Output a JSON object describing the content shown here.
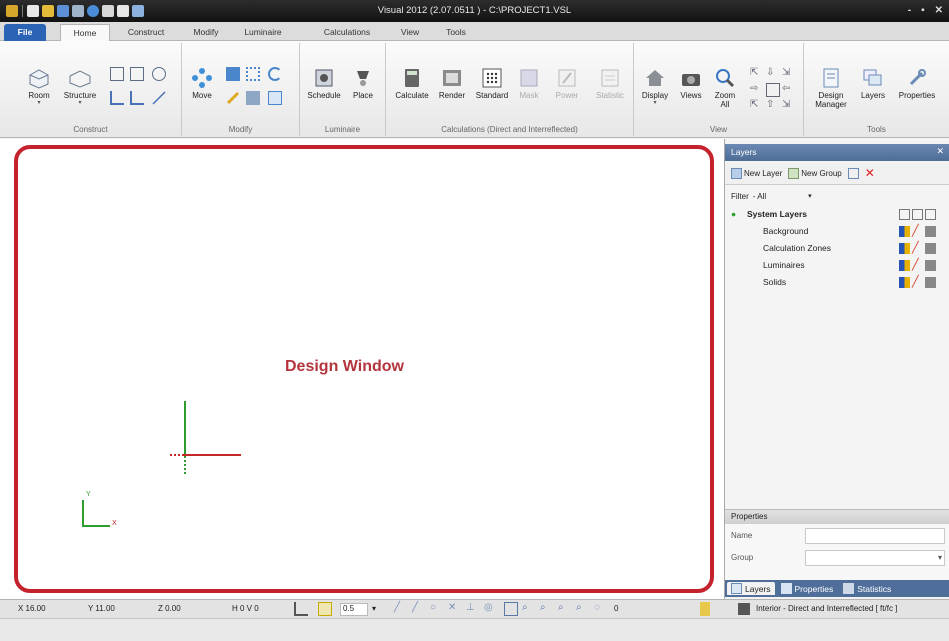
{
  "window": {
    "title": "Visual 2012 (2.07.0511 ) - C:\\PROJECT1.VSL",
    "min": "-",
    "restore": "▪",
    "close": "✕"
  },
  "tabs": [
    "File",
    "Home",
    "Construct",
    "Modify",
    "Luminaire",
    "Calculations",
    "View",
    "Tools"
  ],
  "active_tab": "Home",
  "ribbon": {
    "construct": {
      "label": "Construct",
      "room": "Room",
      "structure": "Structure"
    },
    "modify": {
      "label": "Modify",
      "move": "Move"
    },
    "luminaire": {
      "label": "Luminaire",
      "schedule": "Schedule",
      "place": "Place"
    },
    "calculations": {
      "label": "Calculations (Direct and Interreflected)",
      "calculate": "Calculate",
      "render": "Render",
      "standard": "Standard",
      "mask": "Mask",
      "power": "Power",
      "statistic": "Statistic"
    },
    "view": {
      "label": "View",
      "display": "Display",
      "views": "Views",
      "zoom": "Zoom",
      "zoom_all": "All"
    },
    "tools": {
      "label": "Tools",
      "design": "Design",
      "manager": "Manager",
      "layers": "Layers",
      "properties": "Properties"
    }
  },
  "design": {
    "label": "Design Window",
    "axis_y": "Y",
    "axis_x": "X"
  },
  "layers_panel": {
    "title": "Layers",
    "close": "✕",
    "new_layer": "New Layer",
    "new_group": "New Group",
    "filter_label": "Filter",
    "filter_value": "- All",
    "group": "System Layers",
    "items": [
      "Background",
      "Calculation Zones",
      "Luminaires",
      "Solids"
    ]
  },
  "properties": {
    "title": "Properties",
    "name_label": "Name",
    "group_label": "Group"
  },
  "panel_tabs": [
    "Layers",
    "Properties",
    "Statistics"
  ],
  "status": {
    "x": "X 16.00",
    "y": "Y 11.00",
    "z": "Z 0.00",
    "hv": "H 0 V 0",
    "snap": "0.5",
    "count": "0",
    "calc_mode": "Interior - Direct and Interreflected [ ft/fc ]"
  },
  "colors": {
    "frame": "#c4232e",
    "label": "#b3353d",
    "axis_x": "#c62828",
    "axis_y": "#2e9d2e"
  }
}
